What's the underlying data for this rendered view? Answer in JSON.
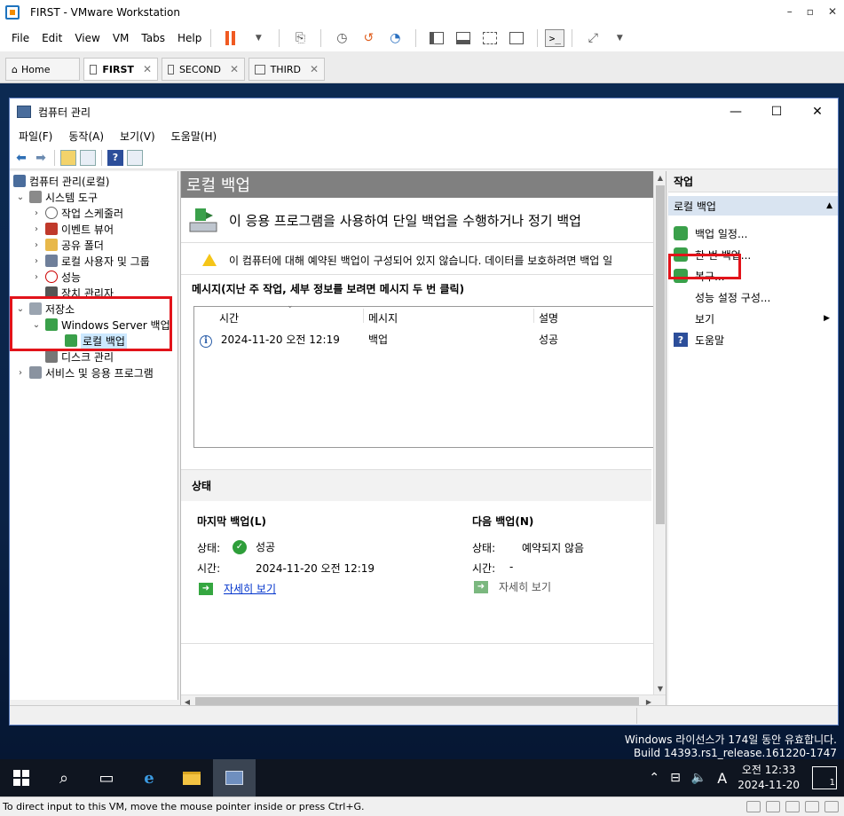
{
  "vmware": {
    "title": "FIRST - VMware Workstation",
    "menu": [
      "File",
      "Edit",
      "View",
      "VM",
      "Tabs",
      "Help"
    ],
    "tabs": [
      "Home",
      "FIRST",
      "SECOND",
      "THIRD"
    ],
    "status_text": "To direct input to this VM, move the mouse pointer inside or press Ctrl+G."
  },
  "window": {
    "title": "컴퓨터 관리",
    "menu": [
      "파일(F)",
      "동작(A)",
      "보기(V)",
      "도움말(H)"
    ]
  },
  "tree": [
    {
      "label": "컴퓨터 관리(로컬)",
      "icon": "computer-management-icon"
    },
    {
      "label": "시스템 도구",
      "icon": "system-tools-icon"
    },
    {
      "label": "작업 스케줄러",
      "icon": "task-scheduler-icon"
    },
    {
      "label": "이벤트 뷰어",
      "icon": "event-viewer-icon"
    },
    {
      "label": "공유 폴더",
      "icon": "shared-folders-icon"
    },
    {
      "label": "로컬 사용자 및 그룹",
      "icon": "local-users-icon"
    },
    {
      "label": "성능",
      "icon": "performance-icon"
    },
    {
      "label": "장치 관리자",
      "icon": "device-manager-icon"
    },
    {
      "label": "저장소",
      "icon": "storage-icon"
    },
    {
      "label": "Windows Server 백업",
      "icon": "windows-server-backup-icon"
    },
    {
      "label": "로컬 백업",
      "icon": "local-backup-icon"
    },
    {
      "label": "디스크 관리",
      "icon": "disk-management-icon"
    },
    {
      "label": "서비스 및 응용 프로그램",
      "icon": "services-apps-icon"
    }
  ],
  "center": {
    "header": "로컬 백업",
    "banner": "이 응용 프로그램을 사용하여 단일 백업을 수행하거나 정기 백업",
    "warning": "이 컴퓨터에 대해 예약된 백업이 구성되어 있지 않습니다. 데이터를 보호하려면 백업 일",
    "messages_title": "메시지(지난 주 작업, 세부 정보를 보려면 메시지 두 번 클릭)",
    "columns": [
      "시간",
      "메시지",
      "설명"
    ],
    "rows": [
      {
        "time": "2024-11-20 오전 12:19",
        "message": "백업",
        "description": "성공"
      }
    ],
    "status": {
      "title": "상태",
      "last_backup": {
        "title": "마지막 백업(L)",
        "status_label": "상태:",
        "status_value": "성공",
        "time_label": "시간:",
        "time_value": "2024-11-20 오전 12:19",
        "link": "자세히 보기"
      },
      "next_backup": {
        "title": "다음 백업(N)",
        "status_label": "상태:",
        "status_value": "예약되지 않음",
        "time_label": "시간:",
        "time_value": "-",
        "link": "자세히 보기"
      }
    }
  },
  "actions": {
    "header": "작업",
    "section": "로컬 백업",
    "items": [
      "백업 일정...",
      "한 번 백업...",
      "복구...",
      "성능 설정 구성...",
      "보기",
      "도움말"
    ]
  },
  "desktop": {
    "watermark_line1": "Windows 라이선스가 174일 동안 유효합니다.",
    "watermark_line2": "Build 14393.rs1_release.161220-1747"
  },
  "taskbar": {
    "time": "오전 12:33",
    "date": "2024-11-20",
    "ime": "A",
    "notification_count": "1"
  }
}
